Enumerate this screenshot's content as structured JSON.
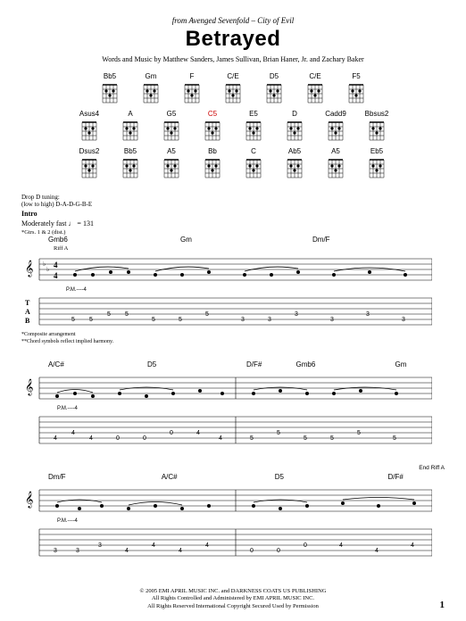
{
  "header": {
    "source_prefix": "from Avenged Sevenfold – ",
    "source_album": "City of Evil",
    "title": "Betrayed",
    "credits": "Words and Music by Matthew Sanders, James Sullivan, Brian Haner, Jr. and Zachary Baker"
  },
  "chord_rows": [
    [
      "Bb5",
      "Gm",
      "F",
      "C/E",
      "D5",
      "C/E",
      "F5"
    ],
    [
      "Asus4",
      "A",
      "G5",
      "C5",
      "E5",
      "D",
      "Cadd9",
      "Bbsus2"
    ],
    [
      "Dsus2",
      "Bb5",
      "A5",
      "Bb",
      "C",
      "Ab5",
      "A5",
      "Eb5"
    ]
  ],
  "tuning_label": "Drop D tuning:",
  "tuning_detail": "(low to high) D-A-D-G-B-E",
  "section": "Intro",
  "tempo": "Moderately fast ♩ = 131",
  "gtr_note": "*Gtrs. 1 & 2 (dist.)",
  "riff_label": "Riff A",
  "end_riff_label": "End Riff A",
  "systems": [
    {
      "chords": [
        "Gmb6",
        "",
        "Gm",
        "",
        "Dm/F",
        ""
      ],
      "pm": "P.M.----4",
      "footnotes": [
        "*Composite arrangement",
        "**Chord symbols reflect implied harmony."
      ]
    },
    {
      "chords": [
        "A/C#",
        "",
        "D5",
        "",
        "D/F#",
        "Gmb6",
        "",
        "Gm"
      ],
      "pm": "P.M.----4"
    },
    {
      "chords": [
        "Dm/F",
        "",
        "A/C#",
        "",
        "D5",
        "",
        "D/F#"
      ],
      "pm": "P.M.----4"
    }
  ],
  "footer": {
    "line1": "© 2005 EMI APRIL MUSIC INC. and DARKNESS COATS US PUBLISHING",
    "line2": "All Rights Controlled and Administered by EMI APRIL MUSIC INC.",
    "line3": "All Rights Reserved   International Copyright Secured   Used by Permission"
  },
  "page": "1"
}
